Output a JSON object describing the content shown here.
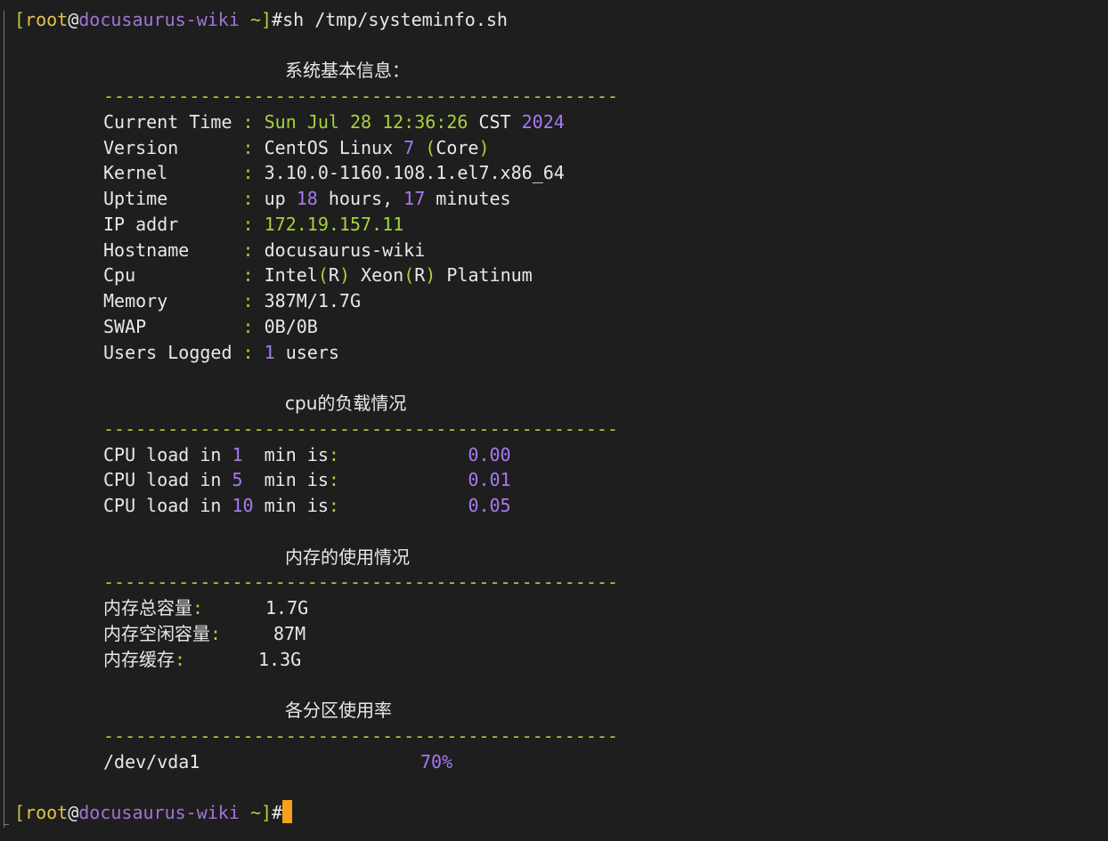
{
  "prompt": {
    "open": "[",
    "user": "root",
    "at": "@",
    "host": "docusaurus-wiki",
    "space": " ",
    "tilde": "~",
    "close": "]",
    "hash": "#"
  },
  "command": "sh /tmp/systeminfo.sh",
  "sections": {
    "system": {
      "title": "系统基本信息：",
      "divider": "------------------------------------------------",
      "rows": {
        "time": {
          "label": "Current Time",
          "sep": " : ",
          "v1": "Sun Jul 28 12:36:26",
          "v2": " CST ",
          "v3": "2024"
        },
        "version": {
          "label": "Version     ",
          "sep": " : ",
          "v1": "CentOS Linux ",
          "v2": "7",
          "v3": " (",
          "v4": "Core",
          "v5": ")"
        },
        "kernel": {
          "label": "Kernel      ",
          "sep": " : ",
          "v1": "3.10.0-1160.108.1.el7.x86_64"
        },
        "uptime": {
          "label": "Uptime      ",
          "sep": " : ",
          "v1": "up ",
          "v2": "18",
          "v3": " hours, ",
          "v4": "17",
          "v5": " minutes"
        },
        "ip": {
          "label": "IP addr     ",
          "sep": " : ",
          "v1": "172.19.157.11"
        },
        "hostname": {
          "label": "Hostname    ",
          "sep": " : ",
          "v1": "docusaurus-wiki"
        },
        "cpu": {
          "label": "Cpu         ",
          "sep": " : ",
          "v1": "Intel",
          "v2": "(",
          "v3": "R",
          "v4": ")",
          "v5": " Xeon",
          "v6": "(",
          "v7": "R",
          "v8": ")",
          "v9": " Platinum"
        },
        "memory": {
          "label": "Memory      ",
          "sep": " : ",
          "v1": "387M/1.7G"
        },
        "swap": {
          "label": "SWAP        ",
          "sep": " : ",
          "v1": "0B/0B"
        },
        "users": {
          "label": "Users Logged",
          "sep": " : ",
          "v1": "1",
          "v2": " users"
        }
      }
    },
    "cpu_load": {
      "title": "cpu的负载情况",
      "divider": "------------------------------------------------",
      "rows": [
        {
          "pre": "CPU load in ",
          "n": "1",
          "mid": "  min is",
          "colon": ":",
          "pad": "            ",
          "val": "0.00"
        },
        {
          "pre": "CPU load in ",
          "n": "5",
          "mid": "  min is",
          "colon": ":",
          "pad": "            ",
          "val": "0.01"
        },
        {
          "pre": "CPU load in ",
          "n": "10",
          "mid": " min is",
          "colon": ":",
          "pad": "            ",
          "val": "0.05"
        }
      ]
    },
    "memory_usage": {
      "title": "内存的使用情况",
      "divider": "------------------------------------------------",
      "rows": [
        {
          "label": "内存总容量",
          "colon": ":",
          "val": "1.7G"
        },
        {
          "label": "内存空闲容量",
          "colon": ":",
          "val": "87M"
        },
        {
          "label": "内存缓存",
          "colon": ":",
          "val": "1.3G"
        }
      ]
    },
    "partition": {
      "title": "各分区使用率",
      "divider": "------------------------------------------------",
      "rows": [
        {
          "device": "/dev/vda1",
          "usage": "70%"
        }
      ]
    }
  },
  "colors": {
    "background": "#1e1e1e",
    "text": "#e8e8e8",
    "green": "#a6d23a",
    "purple": "#a779f0",
    "cursor": "#f8a11b"
  }
}
